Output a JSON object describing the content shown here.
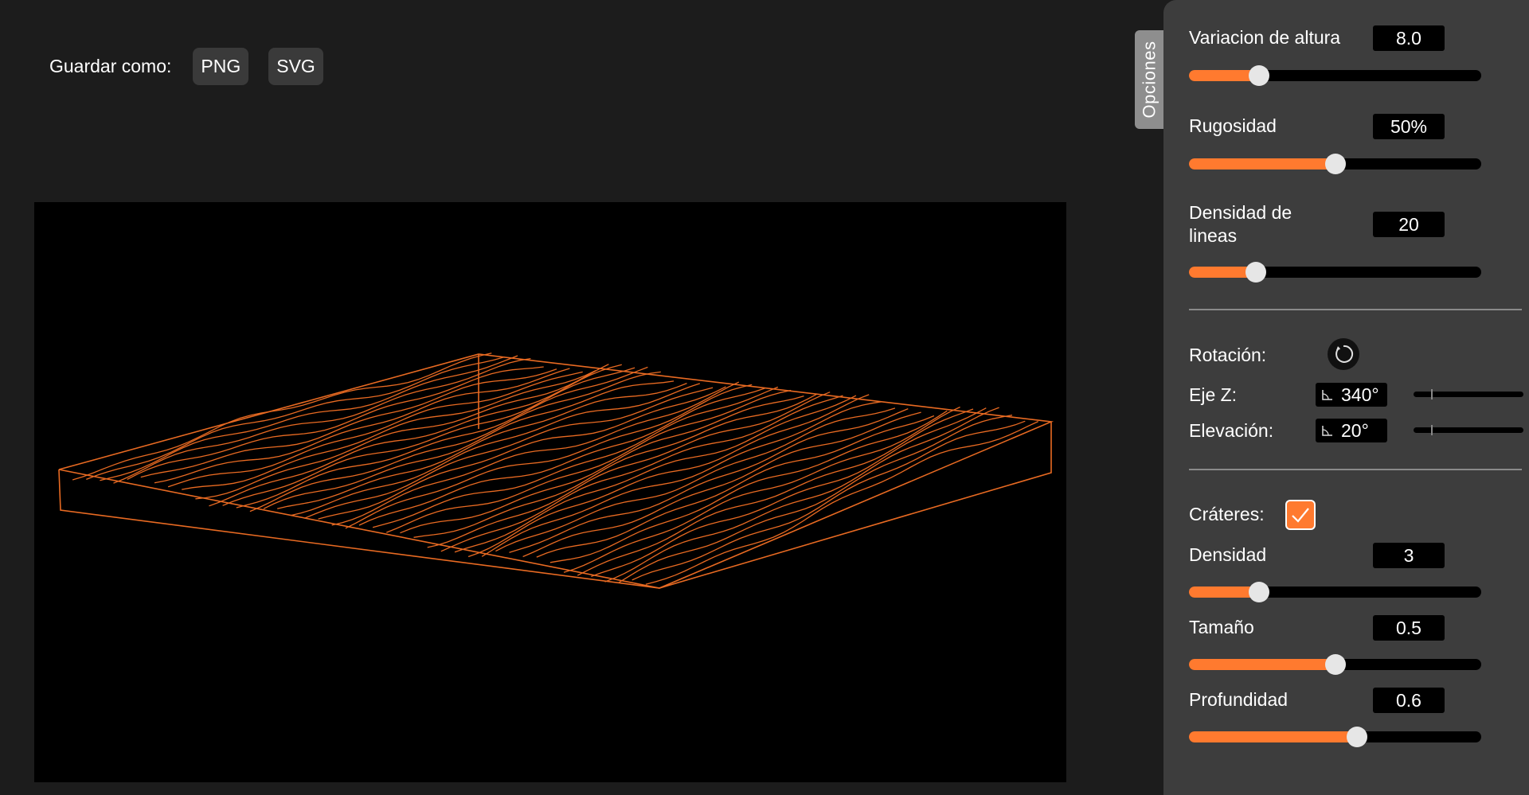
{
  "toolbar": {
    "save_label": "Guardar como:",
    "png_label": "PNG",
    "svg_label": "SVG"
  },
  "panel": {
    "tab_label": "Opciones",
    "height_variation": {
      "label": "Variacion de altura",
      "value": "8.0",
      "fraction": 0.24
    },
    "roughness": {
      "label": "Rugosidad",
      "value": "50%",
      "fraction": 0.5
    },
    "line_density": {
      "label_line1": "Densidad de",
      "label_line2": "lineas",
      "value": "20",
      "fraction": 0.23
    },
    "rotation": {
      "label": "Rotación:",
      "icon": "rotate-icon"
    },
    "z_axis": {
      "label": "Eje Z:",
      "value": "340°",
      "fraction": 0.16
    },
    "elevation": {
      "label": "Elevación:",
      "value": "20°",
      "fraction": 0.16
    },
    "craters": {
      "label": "Cráteres:",
      "checked": true
    },
    "crater_density": {
      "label": "Densidad",
      "value": "3",
      "fraction": 0.24
    },
    "crater_size": {
      "label": "Tamaño",
      "value": "0.5",
      "fraction": 0.5
    },
    "crater_depth": {
      "label": "Profundidad",
      "value": "0.6",
      "fraction": 0.575
    }
  },
  "colors": {
    "accent": "#ff7a2f",
    "panel_bg": "#3d3d3d",
    "page_bg": "#1c1c1c"
  }
}
